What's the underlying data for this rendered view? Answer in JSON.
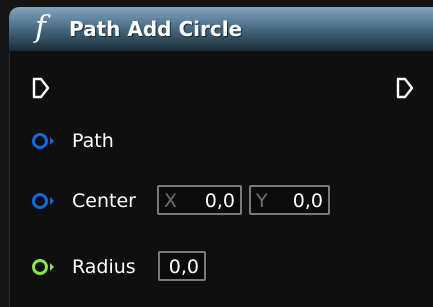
{
  "node": {
    "title": "Path Add Circle",
    "function_icon": "f",
    "header_color": "#5e819b"
  },
  "pins": {
    "exec_in": {
      "icon": "exec-pin-icon"
    },
    "exec_out": {
      "icon": "exec-pin-icon"
    },
    "path": {
      "label": "Path",
      "icon": "object-pin-icon",
      "color": "#0a6ce0"
    },
    "center": {
      "label": "Center",
      "icon": "vector2d-pin-icon",
      "color": "#0a6ce0",
      "x_axis": "X",
      "x_value": "0,0",
      "y_axis": "Y",
      "y_value": "0,0"
    },
    "radius": {
      "label": "Radius",
      "icon": "float-pin-icon",
      "color": "#8be34b",
      "value": "0,0"
    }
  }
}
